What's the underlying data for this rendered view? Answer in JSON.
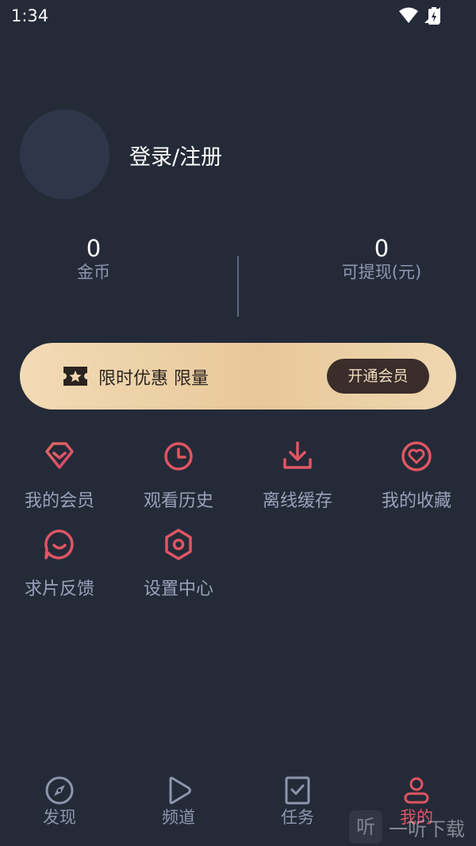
{
  "status_bar": {
    "time": "1:34",
    "icons": [
      "wifi-icon",
      "signal-icon",
      "battery-icon"
    ]
  },
  "profile": {
    "login_label": "登录/注册"
  },
  "stats": {
    "coins": {
      "value": "0",
      "label": "金币"
    },
    "withdrawable": {
      "value": "0",
      "label": "可提现(元)"
    }
  },
  "vip_banner": {
    "promo_text": "限时优惠 限量",
    "button_label": "开通会员"
  },
  "menu": [
    {
      "label": "我的会员",
      "icon": "diamond-icon"
    },
    {
      "label": "观看历史",
      "icon": "clock-icon"
    },
    {
      "label": "离线缓存",
      "icon": "download-icon"
    },
    {
      "label": "我的收藏",
      "icon": "heart-icon"
    },
    {
      "label": "求片反馈",
      "icon": "feedback-icon"
    },
    {
      "label": "设置中心",
      "icon": "settings-hexagon-icon"
    }
  ],
  "tabs": [
    {
      "label": "发现",
      "icon": "compass-icon",
      "active": false
    },
    {
      "label": "频道",
      "icon": "play-icon",
      "active": false
    },
    {
      "label": "任务",
      "icon": "task-icon",
      "active": false
    },
    {
      "label": "我的",
      "icon": "person-icon",
      "active": true
    }
  ],
  "watermark": {
    "badge": "听",
    "text": "一听下载"
  },
  "colors": {
    "background": "#252a38",
    "accent": "#e05563",
    "gold": "#e7c89a"
  }
}
